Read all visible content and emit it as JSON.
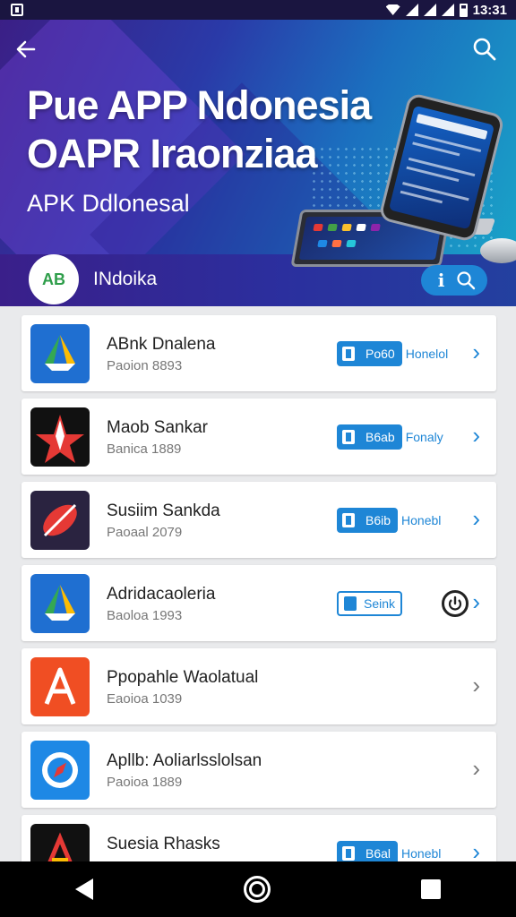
{
  "status_bar": {
    "time": "13:31"
  },
  "header": {
    "title_line1": "Pue  APP Ndonesia",
    "title_line2": "OAPR Iraonziaa",
    "subtitle": "APK Ddlonesal",
    "brand_logo_text": "AB",
    "brand_name": "INdoika",
    "info_label": "i"
  },
  "apps": [
    {
      "name": "ABnk Dnalena",
      "meta": "Paoion 8893",
      "button": "Po60",
      "extra": "Honelol",
      "icon": "drive-icon",
      "color": "#1f6fd1"
    },
    {
      "name": "Maob Sankar",
      "meta": "Banica 1889",
      "button": "B6ab",
      "extra": "Fonaly",
      "icon": "star-icon",
      "color": "#111111"
    },
    {
      "name": "Susiim Sankda",
      "meta": "Paoaal 2079",
      "button": "B6ib",
      "extra": "Honebl",
      "icon": "leaf-icon",
      "color": "#2a2340"
    },
    {
      "name": "Adridacaoleria",
      "meta": "Baoloa 1993",
      "button": "Seink",
      "extra": "",
      "icon": "drive-icon",
      "color": "#1f6fd1"
    },
    {
      "name": "Ppopahle Waolatual",
      "meta": "Eaoioa 1039",
      "button": "",
      "extra": "",
      "icon": "a-logo-icon",
      "color": "#f04e23"
    },
    {
      "name": "Apllb: Aoliarlsslolsan",
      "meta": "Paoioa 1889",
      "button": "",
      "extra": "",
      "icon": "compass-icon",
      "color": "#1e88e5"
    },
    {
      "name": "Suesia Rhasks",
      "meta": "",
      "button": "B6al",
      "extra": "Honebl",
      "icon": "a-logo-icon",
      "color": "#111111"
    }
  ]
}
